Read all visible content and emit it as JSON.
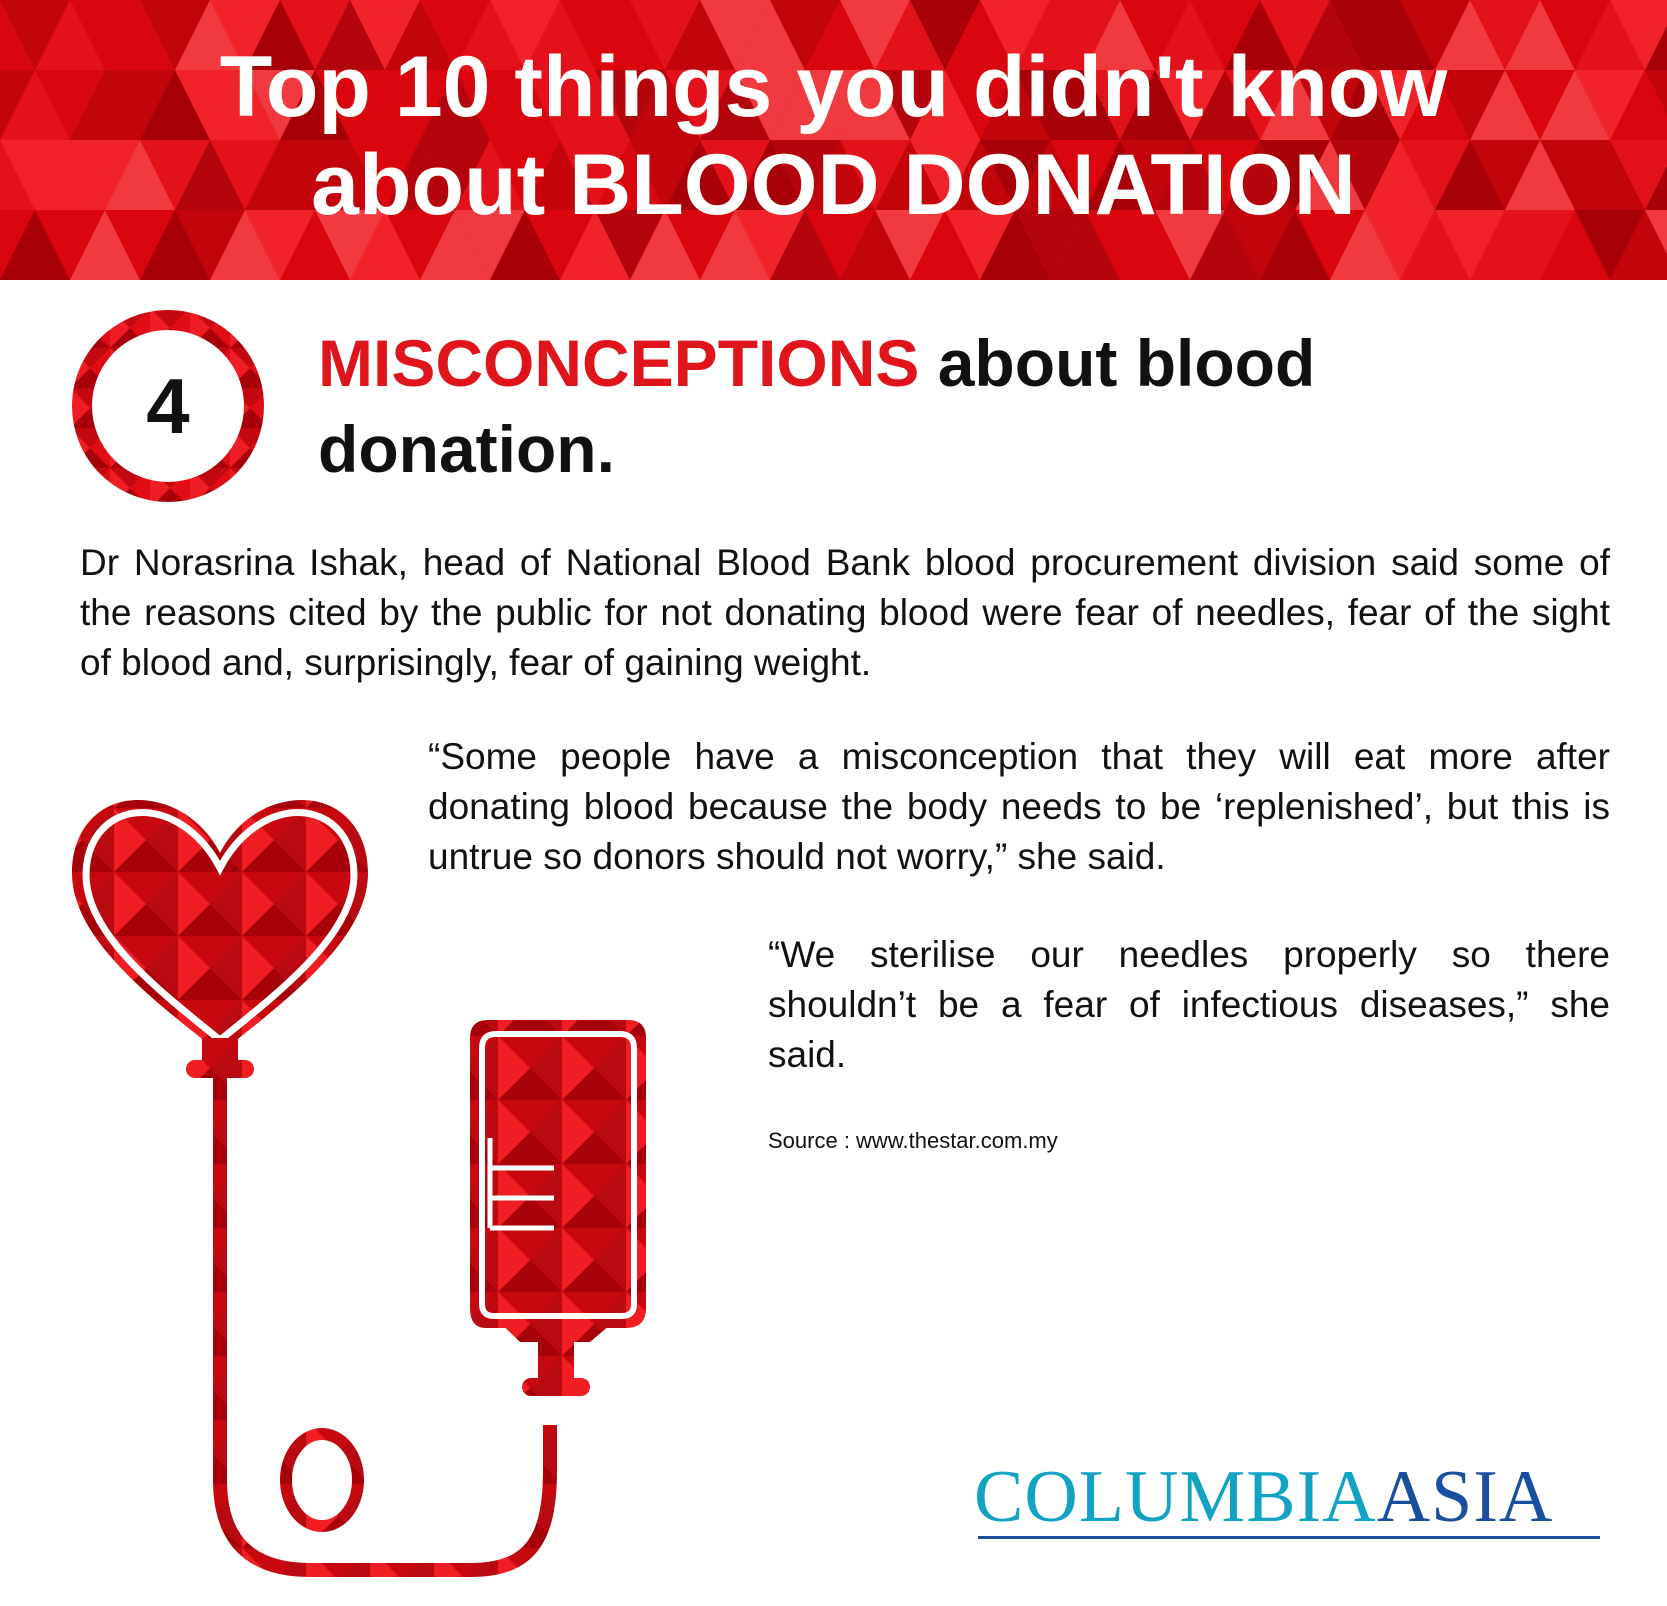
{
  "banner": {
    "title_line1": "Top 10 things you didn't know",
    "title_line2": "about BLOOD DONATION",
    "color": "#d9070d"
  },
  "section": {
    "number": "4",
    "heading_accent": "MISCONCEPTIONS",
    "heading_rest": " about blood donation.",
    "accent_color": "#e0141b"
  },
  "body": {
    "paragraph": "Dr Norasrina Ishak, head of National Blood Bank blood procurement division said some of the reasons cited by the public for not donating blood were fear of needles, fear of the sight of blood and, surprisingly, fear of gaining weight.",
    "quote1": "“Some people have a misconception that they will eat more after donating blood because the body needs to be ‘replenished’, but this is untrue so donors should not worry,” she said.",
    "quote2": "“We sterilise our needles properly so there shouldn’t be a fear of infectious diseases,” she said.",
    "source": "Source : www.thestar.com.my"
  },
  "illustration": {
    "icon": "heart-blood-bag-icon"
  },
  "logo": {
    "part1": "COLUMBIA",
    "part2": "ASIA",
    "color_primary": "#12a3c4",
    "color_secondary": "#1a4fa0"
  }
}
